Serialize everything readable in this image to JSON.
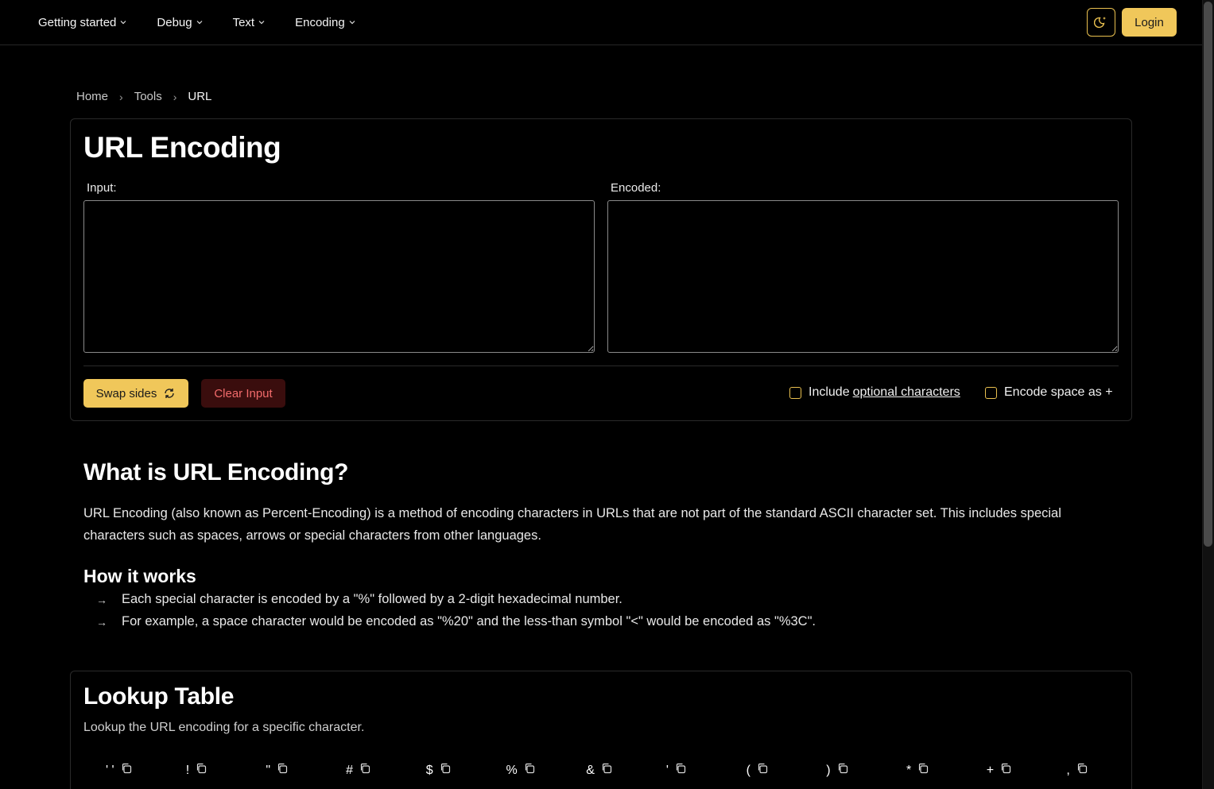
{
  "nav": {
    "items": [
      {
        "label": "Getting started"
      },
      {
        "label": "Debug"
      },
      {
        "label": "Text"
      },
      {
        "label": "Encoding"
      }
    ],
    "theme_icon": "moon-icon",
    "login_label": "Login"
  },
  "breadcrumb": [
    "Home",
    "Tools",
    "URL"
  ],
  "tool": {
    "title": "URL Encoding",
    "input_label": "Input:",
    "input_value": "",
    "encoded_label": "Encoded:",
    "encoded_value": "",
    "swap_label": "Swap sides",
    "clear_label": "Clear Input",
    "opt1_prefix": "Include",
    "opt1_link": "optional characters",
    "opt2_label": "Encode space as +"
  },
  "article": {
    "heading": "What is URL Encoding?",
    "paragraph": "URL Encoding (also known as Percent-Encoding) is a method of encoding characters in URLs that are not part of the standard ASCII character set. This includes special characters such as spaces, arrows or special characters from other languages.",
    "how_heading": "How it works",
    "bullets": [
      "Each special character is encoded by a \"%\" followed by a 2-digit hexadecimal number.",
      "For example, a space character would be encoded as \"%20\" and the less-than symbol \"<\" would be encoded as \"%3C\"."
    ]
  },
  "lookup": {
    "heading": "Lookup Table",
    "subtitle": "Lookup the URL encoding for a specific character.",
    "chars": [
      "' '",
      "!",
      "\"",
      "#",
      "$",
      "%",
      "&",
      "'",
      "(",
      ")",
      "*",
      "+",
      ","
    ]
  },
  "colors": {
    "accent": "#f0c75a",
    "danger_bg": "#3a0d0d",
    "danger_text": "#f26b6b",
    "background": "#000000"
  }
}
